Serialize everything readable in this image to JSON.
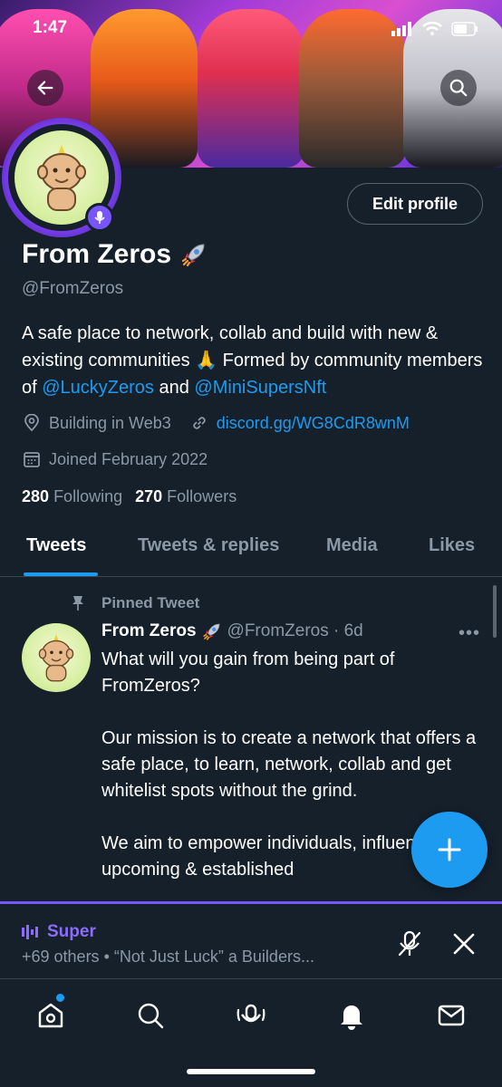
{
  "status_bar": {
    "time": "1:47"
  },
  "profile": {
    "name": "From Zeros",
    "name_emoji": "rocket",
    "handle": "@FromZeros",
    "edit_button": "Edit profile",
    "bio": {
      "line_a": "A safe place to network, collab and build with new & existing communities",
      "emoji": "🙏",
      "line_b": " Formed by community members of ",
      "mention_1": "@LuckyZeros",
      "and": " and ",
      "mention_2": "@MiniSupersNft"
    },
    "location": "Building in Web3",
    "url": "discord.gg/WG8CdR8wnM",
    "joined": "Joined February 2022",
    "following_count": "280",
    "following_label": "Following",
    "followers_count": "270",
    "followers_label": "Followers"
  },
  "tabs": [
    {
      "label": "Tweets",
      "active": true
    },
    {
      "label": "Tweets & replies",
      "active": false
    },
    {
      "label": "Media",
      "active": false
    },
    {
      "label": "Likes",
      "active": false
    }
  ],
  "tweet": {
    "pinned_label": "Pinned Tweet",
    "author": "From Zeros",
    "handle_time": "@FromZeros · 6d",
    "body": "What will you gain from being part of FromZeros?\n\nOur mission is to create a network that offers a safe place, to learn, network, collab and get whitelist spots without the grind.\n\nWe aim to empower individuals, influencers, upcoming & established"
  },
  "space": {
    "title": "Super",
    "subtitle": "+69 others • “Not Just Luck” a Builders..."
  },
  "colors": {
    "background": "#15202b",
    "accent": "#1d9bf0",
    "spaces_purple": "#7856ff",
    "muted_text": "#8b98a5"
  },
  "icons": {
    "back": "back-arrow-icon",
    "search": "search-icon",
    "location": "location-pin-icon",
    "link": "link-icon",
    "calendar": "calendar-icon",
    "pin": "pin-icon",
    "compose": "plus-icon",
    "mic_off": "mic-muted-icon",
    "close": "close-icon",
    "nav": [
      "home-icon",
      "search-icon",
      "spaces-icon",
      "notifications-icon",
      "messages-icon"
    ]
  }
}
